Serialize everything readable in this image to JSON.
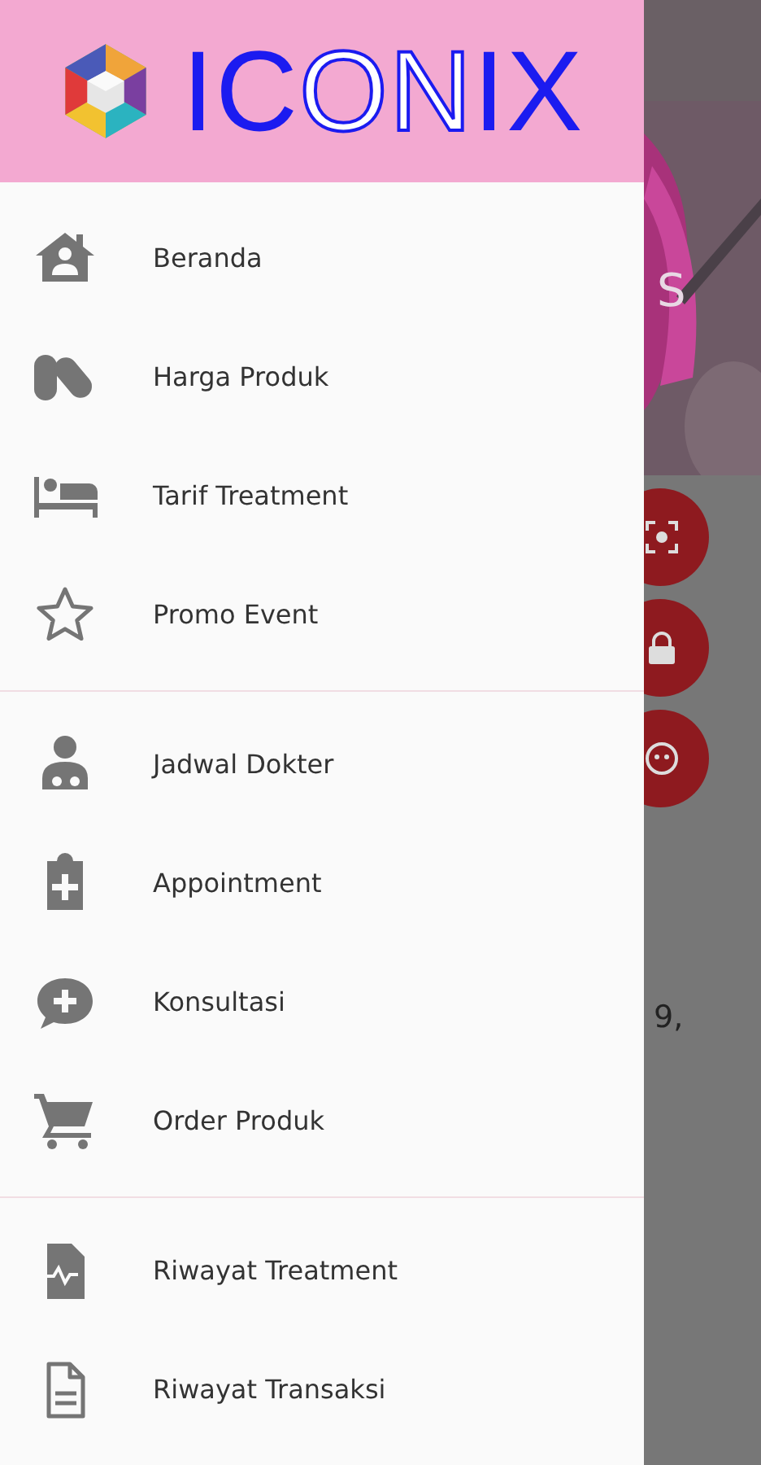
{
  "drawer": {
    "logo": [
      {
        "text": "IC",
        "kind": "solid"
      },
      {
        "text": "ON",
        "kind": "outline"
      },
      {
        "text": "IX",
        "kind": "solid"
      }
    ],
    "sections": [
      {
        "items": [
          {
            "label": "Beranda"
          },
          {
            "label": "Harga Produk"
          },
          {
            "label": "Tarif Treatment"
          },
          {
            "label": "Promo Event"
          }
        ]
      },
      {
        "items": [
          {
            "label": "Jadwal Dokter"
          },
          {
            "label": "Appointment"
          },
          {
            "label": "Konsultasi"
          },
          {
            "label": "Order Produk"
          }
        ]
      },
      {
        "items": [
          {
            "label": "Riwayat Treatment"
          },
          {
            "label": "Riwayat Transaksi"
          }
        ]
      }
    ]
  },
  "background_screen": {
    "heading_fragment": "S",
    "text_fragment": "9,"
  }
}
